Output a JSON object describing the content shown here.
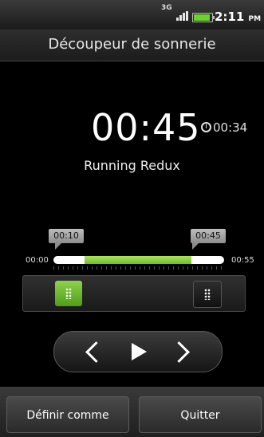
{
  "status_bar": {
    "network": "3G",
    "time": "2:11",
    "ampm": "PM",
    "battery_level": 0.9
  },
  "title": "Découpeur de sonnerie",
  "player": {
    "current_time": "00:45",
    "clip_duration": "00:34",
    "song_title": "Running Redux"
  },
  "range": {
    "start_marker": "00:10",
    "end_marker": "00:45",
    "track_start": "00:00",
    "track_end": "00:55"
  },
  "buttons": {
    "set_as": "Définir comme",
    "quit": "Quitter"
  },
  "icons": {
    "timer": "stopwatch-icon",
    "prev": "chevron-left-icon",
    "play": "play-icon",
    "next": "chevron-right-icon"
  },
  "colors": {
    "accent": "#7cc93a",
    "background": "#000000"
  }
}
